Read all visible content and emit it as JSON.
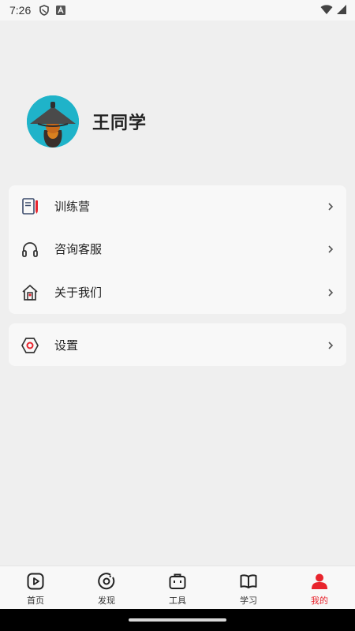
{
  "status_bar": {
    "time": "7:26"
  },
  "profile": {
    "name": "王同学"
  },
  "menu": {
    "items": [
      {
        "label": "训练营",
        "icon": "notebook-icon"
      },
      {
        "label": "咨询客服",
        "icon": "headphones-icon"
      },
      {
        "label": "关于我们",
        "icon": "building-icon"
      }
    ]
  },
  "settings": {
    "label": "设置",
    "icon": "hexagon-settings-icon"
  },
  "tab_bar": {
    "tabs": [
      {
        "label": "首页",
        "icon": "play-icon"
      },
      {
        "label": "发现",
        "icon": "compass-icon"
      },
      {
        "label": "工具",
        "icon": "toolbox-icon"
      },
      {
        "label": "学习",
        "icon": "book-icon"
      },
      {
        "label": "我的",
        "icon": "user-icon",
        "active": true
      }
    ]
  },
  "colors": {
    "accent": "#e8242d",
    "background": "#efefef",
    "card": "#f8f8f8"
  }
}
